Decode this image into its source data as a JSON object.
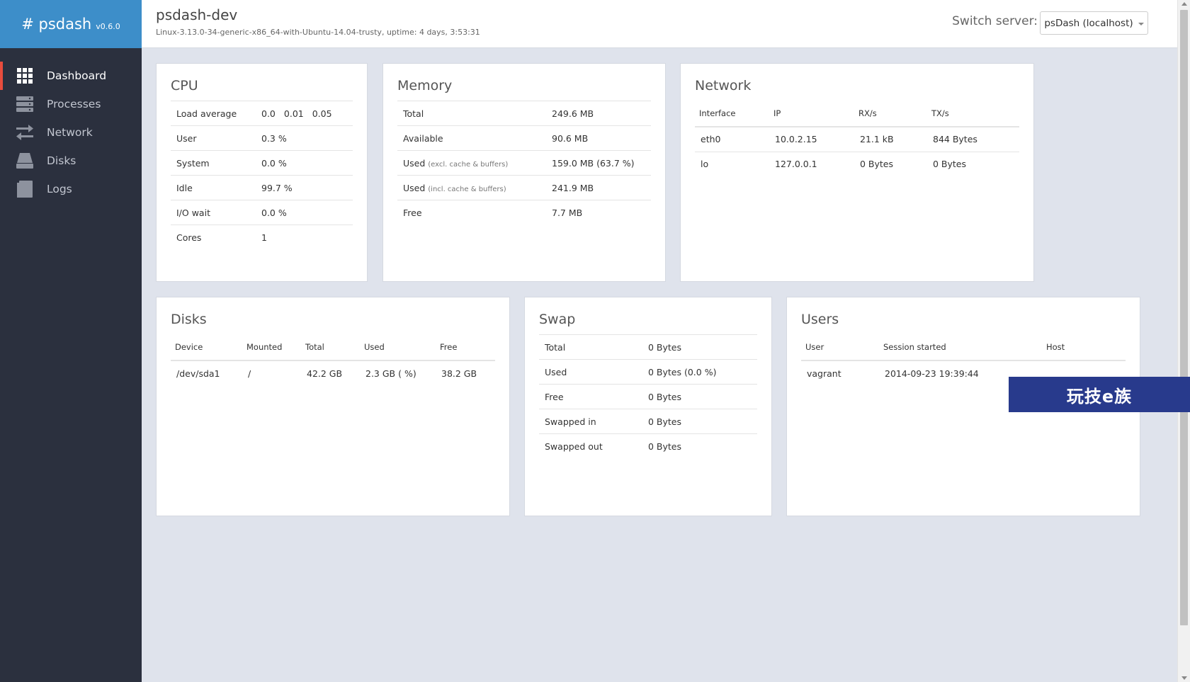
{
  "brand": {
    "name": "# psdash",
    "version": "v0.6.0"
  },
  "sidebar": {
    "items": [
      {
        "label": "Dashboard",
        "icon": "dashboard-grid-icon",
        "active": true
      },
      {
        "label": "Processes",
        "icon": "server-stack-icon"
      },
      {
        "label": "Network",
        "icon": "transfer-arrows-icon"
      },
      {
        "label": "Disks",
        "icon": "disk-drive-icon"
      },
      {
        "label": "Logs",
        "icon": "book-icon"
      }
    ]
  },
  "header": {
    "hostname": "psdash-dev",
    "sysinfo": "Linux-3.13.0-34-generic-x86_64-with-Ubuntu-14.04-trusty, uptime: 4 days, 3:53:31",
    "switch_label": "Switch server:",
    "switch_value": "psDash (localhost)"
  },
  "cpu": {
    "title": "CPU",
    "load_label": "Load average",
    "load": [
      "0.0",
      "0.01",
      "0.05"
    ],
    "rows": [
      {
        "k": "User",
        "v": "0.3 %"
      },
      {
        "k": "System",
        "v": "0.0 %"
      },
      {
        "k": "Idle",
        "v": "99.7 %"
      },
      {
        "k": "I/O wait",
        "v": "0.0 %"
      },
      {
        "k": "Cores",
        "v": "1"
      }
    ]
  },
  "memory": {
    "title": "Memory",
    "rows": [
      {
        "k": "Total",
        "note": "",
        "v": "249.6 MB"
      },
      {
        "k": "Available",
        "note": "",
        "v": "90.6 MB"
      },
      {
        "k": "Used",
        "note": "(excl. cache & buffers)",
        "v": "159.0 MB (63.7 %)"
      },
      {
        "k": "Used",
        "note": "(incl. cache & buffers)",
        "v": "241.9 MB"
      },
      {
        "k": "Free",
        "note": "",
        "v": "7.7 MB"
      }
    ]
  },
  "network": {
    "title": "Network",
    "headers": [
      "Interface",
      "IP",
      "RX/s",
      "TX/s"
    ],
    "rows": [
      [
        "eth0",
        "10.0.2.15",
        "21.1 kB",
        "844 Bytes"
      ],
      [
        "lo",
        "127.0.0.1",
        "0 Bytes",
        "0 Bytes"
      ]
    ]
  },
  "disks": {
    "title": "Disks",
    "headers": [
      "Device",
      "Mounted",
      "Total",
      "Used",
      "Free"
    ],
    "rows": [
      [
        "/dev/sda1",
        "/",
        "42.2 GB",
        "2.3 GB ( %)",
        "38.2 GB"
      ]
    ]
  },
  "swap": {
    "title": "Swap",
    "rows": [
      {
        "k": "Total",
        "v": "0 Bytes"
      },
      {
        "k": "Used",
        "v": "0 Bytes (0.0 %)"
      },
      {
        "k": "Free",
        "v": "0 Bytes"
      },
      {
        "k": "Swapped in",
        "v": "0 Bytes"
      },
      {
        "k": "Swapped out",
        "v": "0 Bytes"
      }
    ]
  },
  "users": {
    "title": "Users",
    "headers": [
      "User",
      "Session started",
      "Host"
    ],
    "rows": [
      [
        "vagrant",
        "2014-09-23 19:39:44",
        ""
      ]
    ]
  },
  "overlay": {
    "text": "玩技e族"
  }
}
